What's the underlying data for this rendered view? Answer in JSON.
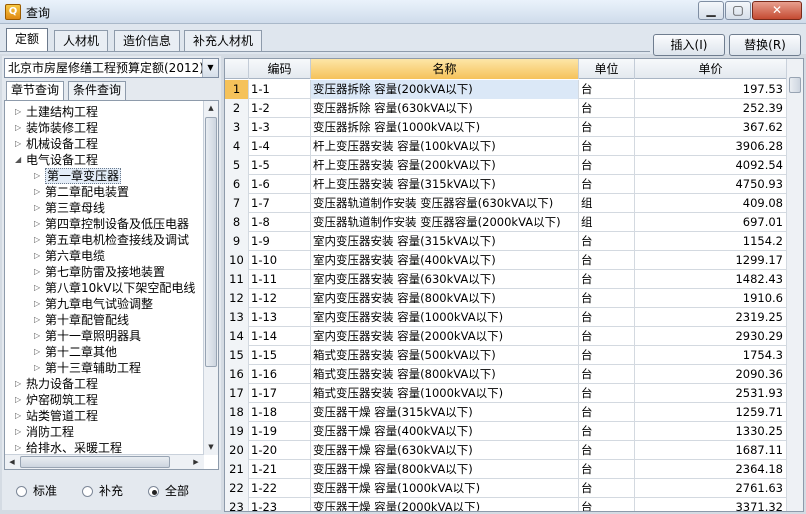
{
  "window": {
    "title": "查询",
    "min_label": "▁",
    "max_label": "▢",
    "close_label": "✕"
  },
  "tabs": [
    "定额",
    "人材机",
    "造价信息",
    "补充人材机"
  ],
  "toolbar": {
    "insert_label": "插入(I)",
    "replace_label": "替换(R)"
  },
  "left": {
    "dropdown_value": "北京市房屋修缮工程预算定额(2012)",
    "subtabs": [
      "章节查询",
      "条件查询"
    ],
    "tree": [
      {
        "label": "土建结构工程",
        "level": 0,
        "expanded": false
      },
      {
        "label": "装饰装修工程",
        "level": 0,
        "expanded": false
      },
      {
        "label": "机械设备工程",
        "level": 0,
        "expanded": false
      },
      {
        "label": "电气设备工程",
        "level": 0,
        "expanded": true
      },
      {
        "label": "第一章变压器",
        "level": 1,
        "expanded": false,
        "selected": true
      },
      {
        "label": "第二章配电装置",
        "level": 1,
        "expanded": false
      },
      {
        "label": "第三章母线",
        "level": 1,
        "expanded": false
      },
      {
        "label": "第四章控制设备及低压电器",
        "level": 1,
        "expanded": false
      },
      {
        "label": "第五章电机检查接线及调试",
        "level": 1,
        "expanded": false
      },
      {
        "label": "第六章电缆",
        "level": 1,
        "expanded": false
      },
      {
        "label": "第七章防雷及接地装置",
        "level": 1,
        "expanded": false
      },
      {
        "label": "第八章10kV以下架空配电线",
        "level": 1,
        "expanded": false
      },
      {
        "label": "第九章电气试验调整",
        "level": 1,
        "expanded": false
      },
      {
        "label": "第十章配管配线",
        "level": 1,
        "expanded": false
      },
      {
        "label": "第十一章照明器具",
        "level": 1,
        "expanded": false
      },
      {
        "label": "第十二章其他",
        "level": 1,
        "expanded": false
      },
      {
        "label": "第十三章辅助工程",
        "level": 1,
        "expanded": false
      },
      {
        "label": "热力设备工程",
        "level": 0,
        "expanded": false
      },
      {
        "label": "炉窑砌筑工程",
        "level": 0,
        "expanded": false
      },
      {
        "label": "站类管道工程",
        "level": 0,
        "expanded": false
      },
      {
        "label": "消防工程",
        "level": 0,
        "expanded": false
      },
      {
        "label": "给排水、采暖工程",
        "level": 0,
        "expanded": false
      }
    ],
    "radios": [
      {
        "label": "标准",
        "checked": false
      },
      {
        "label": "补充",
        "checked": false
      },
      {
        "label": "全部",
        "checked": true
      }
    ]
  },
  "grid": {
    "headers": [
      "编码",
      "名称",
      "单位",
      "单价"
    ],
    "rows": [
      {
        "n": "1",
        "code": "1-1",
        "name": "变压器拆除 容量(200kVA以下)",
        "unit": "台",
        "price": "197.53"
      },
      {
        "n": "2",
        "code": "1-2",
        "name": "变压器拆除 容量(630kVA以下)",
        "unit": "台",
        "price": "252.39"
      },
      {
        "n": "3",
        "code": "1-3",
        "name": "变压器拆除 容量(1000kVA以下)",
        "unit": "台",
        "price": "367.62"
      },
      {
        "n": "4",
        "code": "1-4",
        "name": "杆上变压器安装 容量(100kVA以下)",
        "unit": "台",
        "price": "3906.28"
      },
      {
        "n": "5",
        "code": "1-5",
        "name": "杆上变压器安装 容量(200kVA以下)",
        "unit": "台",
        "price": "4092.54"
      },
      {
        "n": "6",
        "code": "1-6",
        "name": "杆上变压器安装 容量(315kVA以下)",
        "unit": "台",
        "price": "4750.93"
      },
      {
        "n": "7",
        "code": "1-7",
        "name": "变压器轨道制作安装 变压器容量(630kVA以下)",
        "unit": "组",
        "price": "409.08"
      },
      {
        "n": "8",
        "code": "1-8",
        "name": "变压器轨道制作安装 变压器容量(2000kVA以下)",
        "unit": "组",
        "price": "697.01"
      },
      {
        "n": "9",
        "code": "1-9",
        "name": "室内变压器安装 容量(315kVA以下)",
        "unit": "台",
        "price": "1154.2"
      },
      {
        "n": "10",
        "code": "1-10",
        "name": "室内变压器安装 容量(400kVA以下)",
        "unit": "台",
        "price": "1299.17"
      },
      {
        "n": "11",
        "code": "1-11",
        "name": "室内变压器安装 容量(630kVA以下)",
        "unit": "台",
        "price": "1482.43"
      },
      {
        "n": "12",
        "code": "1-12",
        "name": "室内变压器安装 容量(800kVA以下)",
        "unit": "台",
        "price": "1910.6"
      },
      {
        "n": "13",
        "code": "1-13",
        "name": "室内变压器安装 容量(1000kVA以下)",
        "unit": "台",
        "price": "2319.25"
      },
      {
        "n": "14",
        "code": "1-14",
        "name": "室内变压器安装 容量(2000kVA以下)",
        "unit": "台",
        "price": "2930.29"
      },
      {
        "n": "15",
        "code": "1-15",
        "name": "箱式变压器安装 容量(500kVA以下)",
        "unit": "台",
        "price": "1754.3"
      },
      {
        "n": "16",
        "code": "1-16",
        "name": "箱式变压器安装 容量(800kVA以下)",
        "unit": "台",
        "price": "2090.36"
      },
      {
        "n": "17",
        "code": "1-17",
        "name": "箱式变压器安装 容量(1000kVA以下)",
        "unit": "台",
        "price": "2531.93"
      },
      {
        "n": "18",
        "code": "1-18",
        "name": "变压器干燥 容量(315kVA以下)",
        "unit": "台",
        "price": "1259.71"
      },
      {
        "n": "19",
        "code": "1-19",
        "name": "变压器干燥 容量(400kVA以下)",
        "unit": "台",
        "price": "1330.25"
      },
      {
        "n": "20",
        "code": "1-20",
        "name": "变压器干燥 容量(630kVA以下)",
        "unit": "台",
        "price": "1687.11"
      },
      {
        "n": "21",
        "code": "1-21",
        "name": "变压器干燥 容量(800kVA以下)",
        "unit": "台",
        "price": "2364.18"
      },
      {
        "n": "22",
        "code": "1-22",
        "name": "变压器干燥 容量(1000kVA以下)",
        "unit": "台",
        "price": "2761.63"
      },
      {
        "n": "23",
        "code": "1-23",
        "name": "变压器干燥 容量(2000kVA以下)",
        "unit": "台",
        "price": "3371.32"
      }
    ]
  },
  "icons": {
    "app": "query-app-icon",
    "tree_collapsed": "▷",
    "tree_expanded": "◢",
    "dropdown": "▼",
    "scroll_up": "▲",
    "scroll_down": "▼",
    "scroll_left": "◀",
    "scroll_right": "▶"
  },
  "colors": {
    "selection_header": "#f5c25a",
    "selection_row": "#dbe8f7"
  }
}
